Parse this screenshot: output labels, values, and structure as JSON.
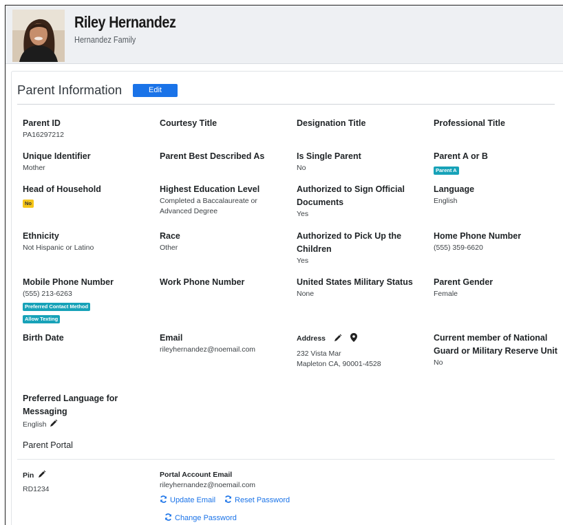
{
  "header": {
    "name": "Riley Hernandez",
    "family": "Hernandez Family"
  },
  "section": {
    "title": "Parent Information",
    "edit_label": "Edit"
  },
  "fields": {
    "parent_id": {
      "label": "Parent ID",
      "value": "PA16297212"
    },
    "courtesy_title": {
      "label": "Courtesy Title",
      "value": ""
    },
    "designation_title": {
      "label": "Designation Title",
      "value": ""
    },
    "professional_title": {
      "label": "Professional Title",
      "value": ""
    },
    "unique_identifier": {
      "label": "Unique Identifier",
      "value": "Mother"
    },
    "best_described": {
      "label": "Parent Best Described As",
      "value": ""
    },
    "single_parent": {
      "label": "Is Single Parent",
      "value": "No"
    },
    "parent_a_or_b": {
      "label": "Parent A or B",
      "badge": "Parent A"
    },
    "head_of_household": {
      "label": "Head of Household",
      "badge": "No"
    },
    "education": {
      "label": "Highest Education Level",
      "value": "Completed a Baccalaureate or Advanced Degree"
    },
    "authorized_sign": {
      "label": "Authorized to Sign Official Documents",
      "value": "Yes"
    },
    "language": {
      "label": "Language",
      "value": "English"
    },
    "ethnicity": {
      "label": "Ethnicity",
      "value": "Not Hispanic or Latino"
    },
    "race": {
      "label": "Race",
      "value": "Other"
    },
    "authorized_pickup": {
      "label": "Authorized to Pick Up the Children",
      "value": "Yes"
    },
    "home_phone": {
      "label": "Home Phone Number",
      "value": "(555) 359-6620"
    },
    "mobile_phone": {
      "label": "Mobile Phone Number",
      "value": "(555) 213-6263",
      "badges": [
        "Preferred Contact Method",
        "Allow Texting"
      ]
    },
    "work_phone": {
      "label": "Work Phone Number",
      "value": ""
    },
    "military_status": {
      "label": "United States Military Status",
      "value": "None"
    },
    "gender": {
      "label": "Parent Gender",
      "value": "Female"
    },
    "birth_date": {
      "label": "Birth Date",
      "value": ""
    },
    "email": {
      "label": "Email",
      "value": "rileyhernandez@noemail.com"
    },
    "address": {
      "label": "Address",
      "line1": "232 Vista Mar",
      "line2": "Mapleton CA, 90001-4528"
    },
    "national_guard": {
      "label": "Current member of National Guard or Military Reserve Unit",
      "value": "No"
    },
    "preferred_language": {
      "label": "Preferred Language for Messaging",
      "value": "English"
    }
  },
  "portal": {
    "title": "Parent Portal",
    "pin_label": "Pin",
    "pin_value": "RD1234",
    "email_label": "Portal Account Email",
    "email_value": "rileyhernandez@noemail.com",
    "update_email": "Update Email",
    "reset_password": "Reset Password",
    "change_password": "Change Password"
  },
  "icons": {
    "edit": "pencil-icon",
    "location": "map-marker-icon",
    "refresh": "refresh-icon"
  },
  "colors": {
    "accent": "#1a73e8",
    "badge_teal": "#17a2b8",
    "badge_yellow": "#f5c518"
  }
}
